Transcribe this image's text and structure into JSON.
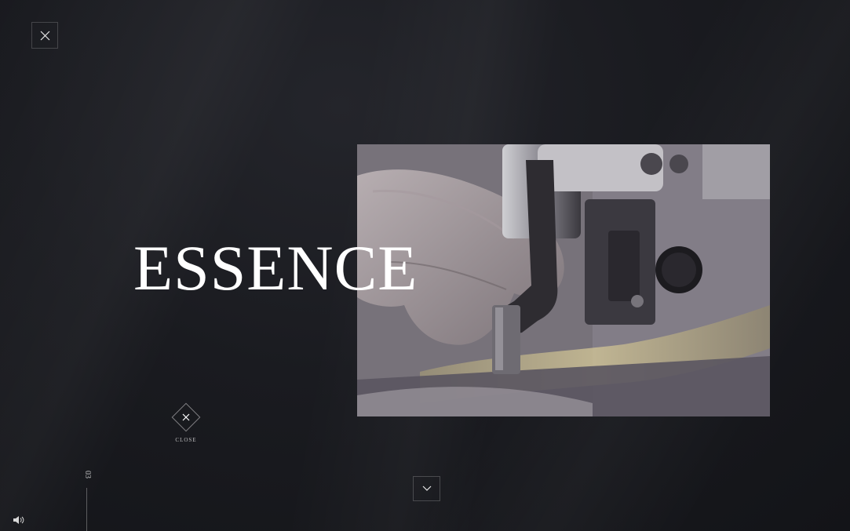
{
  "headline": "ESSENCE",
  "close_label": "CLOSE",
  "counter": "03",
  "icons": {
    "top_close": "close-icon",
    "diamond_close": "close-icon",
    "next": "chevron-down-icon",
    "sound": "speaker-icon"
  },
  "colors": {
    "background": "#17181c",
    "text": "#ffffff"
  }
}
